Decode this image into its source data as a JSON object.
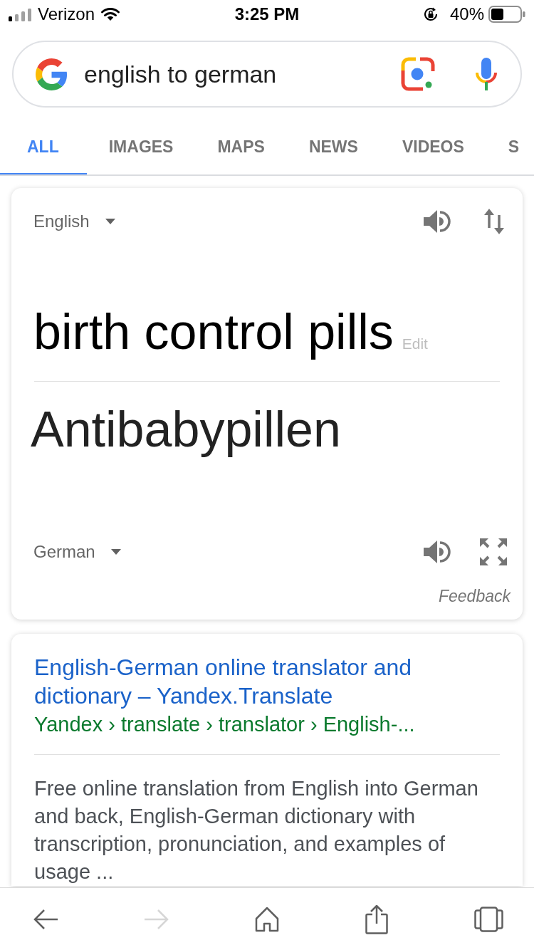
{
  "status_bar": {
    "carrier": "Verizon",
    "time": "3:25 PM",
    "battery_percent": "40%"
  },
  "search": {
    "query": "english to german"
  },
  "tabs": [
    {
      "label": "ALL",
      "selected": true
    },
    {
      "label": "IMAGES",
      "selected": false
    },
    {
      "label": "MAPS",
      "selected": false
    },
    {
      "label": "NEWS",
      "selected": false
    },
    {
      "label": "VIDEOS",
      "selected": false
    },
    {
      "label": "S",
      "selected": false
    }
  ],
  "translation_card": {
    "source_language": "English",
    "source_text": "birth control pills",
    "edit_link": "Edit",
    "translated_text": "Antibabypillen",
    "target_language": "German",
    "feedback_link": "Feedback"
  },
  "search_result": {
    "title": "English-German online translator and dictionary – Yandex.Translate",
    "breadcrumb": "Yandex › translate › translator › English-...",
    "snippet": "Free online translation from English into German and back, English-German dictionary with transcription, pronunciation, and examples of usage ..."
  },
  "toolbar": [
    {
      "kind": "back",
      "disabled": false
    },
    {
      "kind": "forward",
      "disabled": true
    },
    {
      "kind": "home",
      "disabled": false
    },
    {
      "kind": "share",
      "disabled": false
    },
    {
      "kind": "tabs",
      "disabled": false
    }
  ]
}
